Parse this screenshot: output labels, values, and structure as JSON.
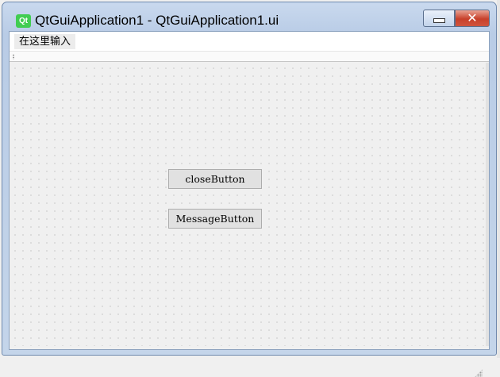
{
  "window": {
    "logo_text": "Qt",
    "title": "QtGuiApplication1 - QtGuiApplication1.ui",
    "close_glyph": "✕",
    "colors": {
      "frame": "#b9cce6",
      "close": "#c7402a",
      "qt_green": "#41cd52"
    }
  },
  "menubar": {
    "placeholder_item": "在这里输入"
  },
  "form": {
    "buttons": {
      "close": "closeButton",
      "message": "MessageButton"
    }
  },
  "icons": [
    "qt-logo-icon",
    "minimize-icon",
    "close-icon",
    "toolbar-handle-icon",
    "size-grip-icon"
  ]
}
